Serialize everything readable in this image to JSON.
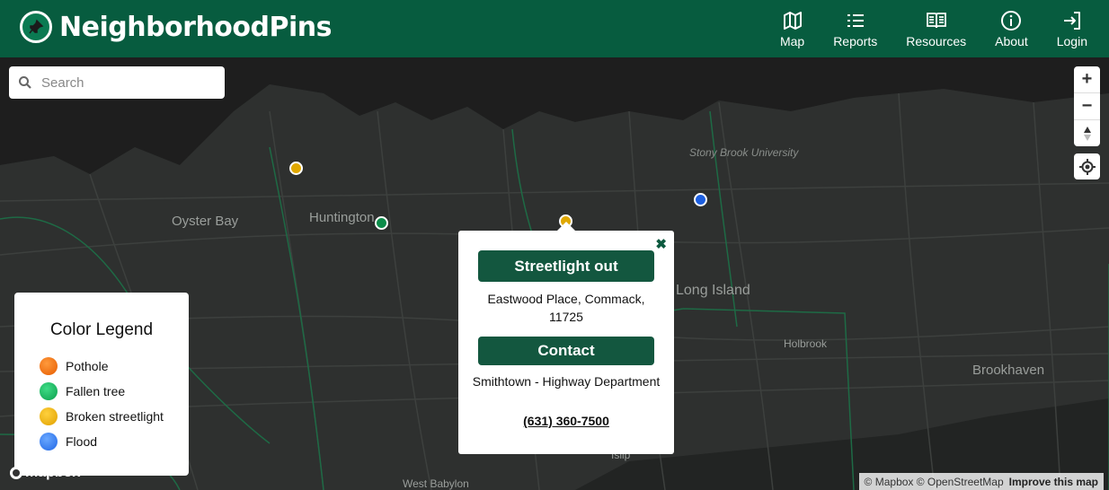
{
  "header": {
    "brand": "NeighborhoodPins",
    "nav": [
      {
        "label": "Map",
        "icon": "map-icon"
      },
      {
        "label": "Reports",
        "icon": "list-icon"
      },
      {
        "label": "Resources",
        "icon": "book-icon"
      },
      {
        "label": "About",
        "icon": "info-icon"
      },
      {
        "label": "Login",
        "icon": "login-icon"
      }
    ]
  },
  "search": {
    "placeholder": "Search",
    "value": ""
  },
  "map": {
    "places": [
      "Oyster Bay",
      "Huntington",
      "Stony Brook University",
      "Long Island",
      "Holbrook",
      "Brookhaven",
      "Islip",
      "West Babylon"
    ],
    "pins": [
      {
        "category": "Broken streetlight",
        "color": "#e0a800"
      },
      {
        "category": "Fallen tree",
        "color": "#0c8c4a"
      },
      {
        "category": "Broken streetlight",
        "color": "#e0a800"
      },
      {
        "category": "Flood",
        "color": "#1d5fe0"
      }
    ]
  },
  "controls": {
    "zoom_in": "+",
    "zoom_out": "−",
    "compass": "▲",
    "locate": "locate-icon"
  },
  "legend": {
    "title": "Color Legend",
    "items": [
      {
        "label": "Pothole",
        "color": "#f06b00"
      },
      {
        "label": "Fallen tree",
        "color": "#12b35c"
      },
      {
        "label": "Broken streetlight",
        "color": "#f2b200"
      },
      {
        "label": "Flood",
        "color": "#3b82f6"
      }
    ]
  },
  "popup": {
    "close": "✖",
    "title": "Streetlight out",
    "address": "Eastwood Place, Commack, 11725",
    "contact_header": "Contact",
    "department": "Smithtown - Highway Department",
    "phone": "(631) 360-7500"
  },
  "attribution": {
    "text": "© Mapbox © OpenStreetMap",
    "improve": "Improve this map"
  },
  "mapbox_logo": "mapbox"
}
